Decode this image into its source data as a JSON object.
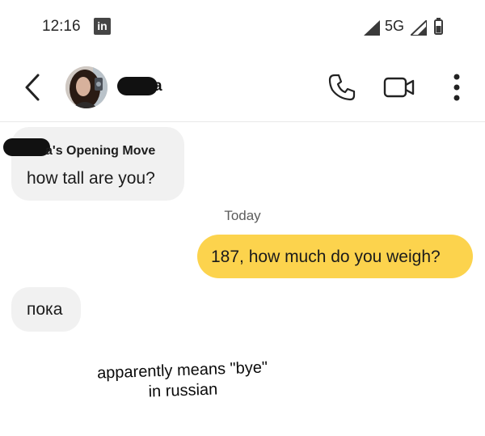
{
  "status_bar": {
    "time": "12:16",
    "notification_app_badge": "in",
    "network_label": "5G",
    "icons": [
      "signal-icon",
      "signal-icon",
      "battery-icon"
    ]
  },
  "header": {
    "back_icon": "chevron-left-icon",
    "contact_name_visible_suffix": "a",
    "actions": [
      "phone-icon",
      "video-camera-icon",
      "more-vertical-icon"
    ]
  },
  "messages": [
    {
      "direction": "incoming",
      "sender_line_visible": "a's Opening Move",
      "text": "how tall are you?"
    },
    {
      "direction": "outgoing",
      "text": "187, how much do you weigh?"
    },
    {
      "direction": "incoming",
      "text": "пока"
    }
  ],
  "date_divider": "Today",
  "caption": {
    "line1": "apparently means \"bye\"",
    "line2": "in russian"
  },
  "colors": {
    "background": "#ffffff",
    "incoming_bubble": "#f1f1f1",
    "outgoing_bubble": "#fcd34d",
    "text": "#1b1b1b",
    "muted_text": "#5c5c5c"
  }
}
